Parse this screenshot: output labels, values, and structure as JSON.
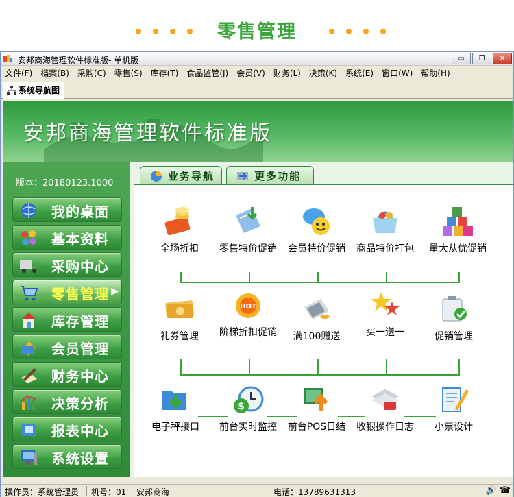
{
  "banner": {
    "title": "零售管理"
  },
  "window": {
    "title": "安邦商海管理软件标准版- 单机版",
    "buttons": {
      "minimize": "▭",
      "restore": "❐",
      "close": "✕"
    }
  },
  "menu": [
    "文件(F)",
    "档案(B)",
    "采购(C)",
    "零售(S)",
    "库存(T)",
    "食品监管(J)",
    "会员(V)",
    "财务(L)",
    "决策(K)",
    "系统(E)",
    "窗口(W)",
    "帮助(H)"
  ],
  "doc_tab": {
    "label": "系统导航图"
  },
  "hero": {
    "title": "安邦商海管理软件标准版"
  },
  "sidebar": {
    "version": "版本：20180123.1000",
    "items": [
      {
        "label": "我的桌面",
        "icon": "globe-icon"
      },
      {
        "label": "基本资料",
        "icon": "color-dots-icon"
      },
      {
        "label": "采购中心",
        "icon": "truck-icon"
      },
      {
        "label": "零售管理",
        "icon": "cart-icon",
        "active": true
      },
      {
        "label": "库存管理",
        "icon": "house-icon"
      },
      {
        "label": "会员管理",
        "icon": "card-icon"
      },
      {
        "label": "财务中心",
        "icon": "pen-paper-icon"
      },
      {
        "label": "决策分析",
        "icon": "bar-chart-icon"
      },
      {
        "label": "报表中心",
        "icon": "report-icon"
      },
      {
        "label": "系统设置",
        "icon": "computer-icon"
      }
    ],
    "report_label": "报表"
  },
  "content_tabs": [
    {
      "label": "业务导航",
      "icon": "pie-icon"
    },
    {
      "label": "更多功能",
      "icon": "arrows-icon"
    }
  ],
  "functions": {
    "row1": [
      {
        "label": "全场折扣",
        "icon": "coins-card-icon"
      },
      {
        "label": "零售特价促销",
        "icon": "book-arrow-icon"
      },
      {
        "label": "会员特价促销",
        "icon": "smiley-chat-icon"
      },
      {
        "label": "商品特价打包",
        "icon": "basket-icon"
      },
      {
        "label": "量大从优促销",
        "icon": "cubes-icon"
      }
    ],
    "row2": [
      {
        "label": "礼券管理",
        "icon": "banknote-icon"
      },
      {
        "label": "阶梯折扣促销",
        "icon": "hot-sun-icon"
      },
      {
        "label": "满100赠送",
        "icon": "cash-register-icon"
      },
      {
        "label": "买一送一",
        "icon": "stars-icon"
      },
      {
        "label": "促销管理",
        "icon": "clipboard-icon"
      }
    ],
    "row3": [
      {
        "label": "电子秤接口",
        "icon": "folder-arrow-icon"
      },
      {
        "label": "前台实时监控",
        "icon": "clock-dollar-icon"
      },
      {
        "label": "前台POS日结",
        "icon": "monitor-arrow-icon"
      },
      {
        "label": "收银操作日志",
        "icon": "stack-card-icon"
      },
      {
        "label": "小票设计",
        "icon": "note-pencil-icon"
      }
    ]
  },
  "statusbar": {
    "operator": "操作员：系统管理员",
    "machine": "机号：01",
    "company": "安邦商海",
    "phone": "电话：13789631313"
  },
  "colors": {
    "accent_green": "#3aa63a",
    "dot_orange": "#f3a51c"
  }
}
